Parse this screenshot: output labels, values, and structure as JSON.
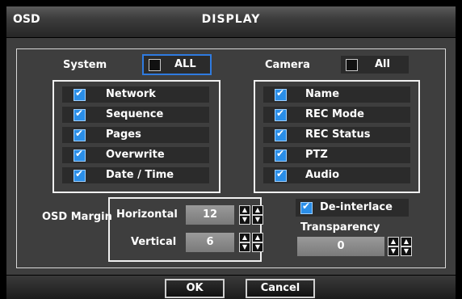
{
  "window": {
    "tag": "OSD",
    "title": "DISPLAY"
  },
  "system": {
    "label": "System",
    "all_label": "ALL",
    "all_checked": false,
    "items": [
      {
        "label": "Network",
        "checked": true
      },
      {
        "label": "Sequence",
        "checked": true
      },
      {
        "label": "Pages",
        "checked": true
      },
      {
        "label": "Overwrite",
        "checked": true
      },
      {
        "label": "Date / Time",
        "checked": true
      }
    ]
  },
  "camera": {
    "label": "Camera",
    "all_label": "All",
    "all_checked": false,
    "items": [
      {
        "label": "Name",
        "checked": true
      },
      {
        "label": "REC Mode",
        "checked": true
      },
      {
        "label": "REC Status",
        "checked": true
      },
      {
        "label": "PTZ",
        "checked": true
      },
      {
        "label": "Audio",
        "checked": true
      }
    ]
  },
  "osd_margin": {
    "label": "OSD Margin",
    "horizontal_label": "Horizontal",
    "horizontal_value": "12",
    "vertical_label": "Vertical",
    "vertical_value": "6"
  },
  "deinterlace": {
    "label": "De-interlace",
    "checked": true
  },
  "transparency": {
    "label": "Transparency",
    "value": "0"
  },
  "buttons": {
    "ok": "OK",
    "cancel": "Cancel"
  },
  "icons": {
    "spin_up": "▲",
    "spin_down": "▼"
  },
  "colors": {
    "accent": "#2a8ee8",
    "selected_border": "#2f7be0",
    "panel": "#3e3e3e"
  }
}
